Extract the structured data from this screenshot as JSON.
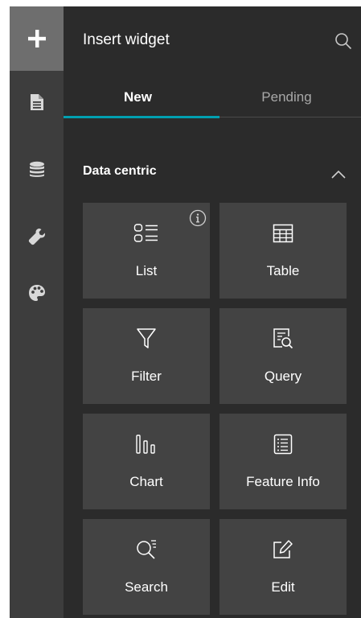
{
  "rail": {
    "items": [
      {
        "icon": "plus-icon",
        "active": true
      },
      {
        "icon": "page-icon",
        "active": false
      },
      {
        "icon": "database-icon",
        "active": false
      },
      {
        "icon": "wrench-icon",
        "active": false
      },
      {
        "icon": "palette-icon",
        "active": false
      }
    ]
  },
  "panel": {
    "title": "Insert widget",
    "search_icon": "search-icon"
  },
  "tabs": [
    {
      "label": "New",
      "selected": true
    },
    {
      "label": "Pending",
      "selected": false
    }
  ],
  "section": {
    "label": "Data centric",
    "expanded": true,
    "chevron_icon": "chevron-up-icon"
  },
  "widgets": [
    {
      "label": "List",
      "icon": "list-icon",
      "has_info": true
    },
    {
      "label": "Table",
      "icon": "table-icon",
      "has_info": false
    },
    {
      "label": "Filter",
      "icon": "filter-icon",
      "has_info": false
    },
    {
      "label": "Query",
      "icon": "query-icon",
      "has_info": false
    },
    {
      "label": "Chart",
      "icon": "chart-icon",
      "has_info": false
    },
    {
      "label": "Feature Info",
      "icon": "feature-info-icon",
      "has_info": false
    },
    {
      "label": "Search",
      "icon": "search-widget-icon",
      "has_info": false
    },
    {
      "label": "Edit",
      "icon": "edit-icon",
      "has_info": false
    }
  ],
  "colors": {
    "rail_bg": "#3d3d3d",
    "rail_active": "#6e6e6e",
    "panel_bg": "#2b2b2b",
    "card_bg": "#434343",
    "accent": "#00a0b0",
    "text": "#ffffff",
    "text_muted": "#a8a8a8"
  }
}
